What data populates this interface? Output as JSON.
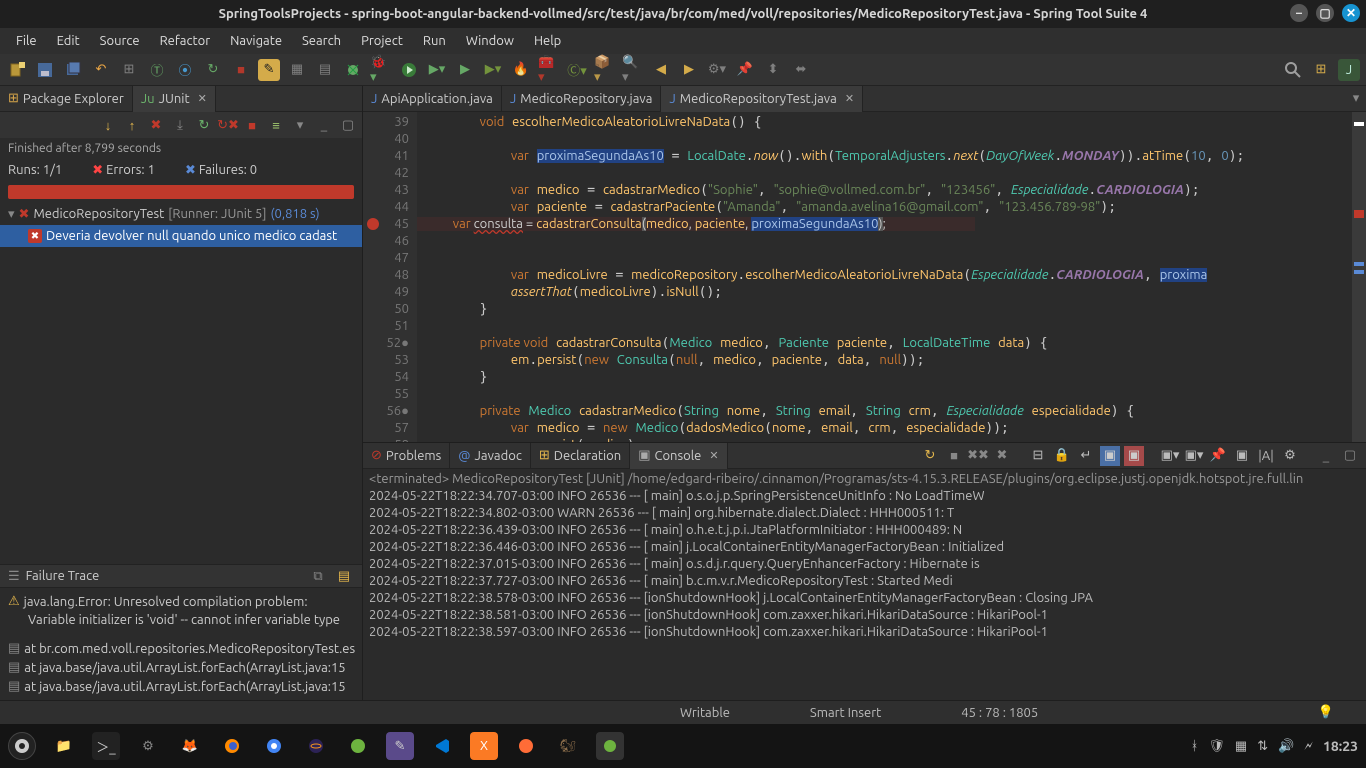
{
  "title": "SpringToolsProjects - spring-boot-angular-backend-vollmed/src/test/java/br/com/med/voll/repositories/MedicoRepositoryTest.java - Spring Tool Suite 4",
  "menu": [
    "File",
    "Edit",
    "Source",
    "Refactor",
    "Navigate",
    "Search",
    "Project",
    "Run",
    "Window",
    "Help"
  ],
  "left_tabs": {
    "pkg": "Package Explorer",
    "junit": "JUnit"
  },
  "junit": {
    "finished": "Finished after 8,799 seconds",
    "runs_lbl": "Runs:",
    "runs_val": "1/1",
    "errors_lbl": "Errors:",
    "errors_val": "1",
    "failures_lbl": "Failures:",
    "failures_val": "0",
    "root": "MedicoRepositoryTest",
    "root_runner": "[Runner: JUnit 5]",
    "root_time": "(0,818 s)",
    "test": "Deveria devolver null quando unico medico cadast"
  },
  "failure": {
    "title": "Failure Trace",
    "l1": "java.lang.Error: Unresolved compilation problem:",
    "l2": "Variable initializer is 'void' -- cannot infer variable type",
    "s1": "at br.com.med.voll.repositories.MedicoRepositoryTest.es",
    "s2": "at java.base/java.util.ArrayList.forEach(ArrayList.java:15",
    "s3": "at java.base/java.util.ArrayList.forEach(ArrayList.java:15"
  },
  "editor_tabs": {
    "t1": "ApiApplication.java",
    "t2": "MedicoRepository.java",
    "t3": "MedicoRepositoryTest.java"
  },
  "bottom_tabs": {
    "p": "Problems",
    "j": "Javadoc",
    "d": "Declaration",
    "c": "Console"
  },
  "console": {
    "term": "<terminated> MedicoRepositoryTest [JUnit] /home/edgard-ribeiro/.cinnamon/Programas/sts-4.15.3.RELEASE/plugins/org.eclipse.justj.openjdk.hotspot.jre.full.lin",
    "lines": [
      "2024-05-22T18:22:34.707-03:00   INFO 26536 --- [           main]  o.s.o.j.p.SpringPersistenceUnitInfo       : No LoadTimeW",
      "2024-05-22T18:22:34.802-03:00   WARN 26536 --- [           main]  org.hibernate.dialect.Dialect             : HHH000511: T",
      "2024-05-22T18:22:36.439-03:00   INFO 26536 --- [           main]  o.h.e.t.j.p.i.JtaPlatformInitiator        : HHH000489: N",
      "2024-05-22T18:22:36.446-03:00   INFO 26536 --- [           main]  j.LocalContainerEntityManagerFactoryBean  : Initialized ",
      "2024-05-22T18:22:37.015-03:00   INFO 26536 --- [           main]  o.s.d.j.r.query.QueryEnhancerFactory      : Hibernate is",
      "2024-05-22T18:22:37.727-03:00   INFO 26536 --- [           main]  b.c.m.v.r.MedicoRepositoryTest            : Started Medi",
      "2024-05-22T18:22:38.578-03:00   INFO 26536 --- [ionShutdownHook]  j.LocalContainerEntityManagerFactoryBean  : Closing JPA ",
      "2024-05-22T18:22:38.581-03:00   INFO 26536 --- [ionShutdownHook]  com.zaxxer.hikari.HikariDataSource        : HikariPool-1",
      "2024-05-22T18:22:38.597-03:00   INFO 26536 --- [ionShutdownHook]  com.zaxxer.hikari.HikariDataSource        : HikariPool-1"
    ]
  },
  "status": {
    "writable": "Writable",
    "smart": "Smart Insert",
    "pos": "45 : 78 : 1805"
  },
  "clock": "18:23"
}
